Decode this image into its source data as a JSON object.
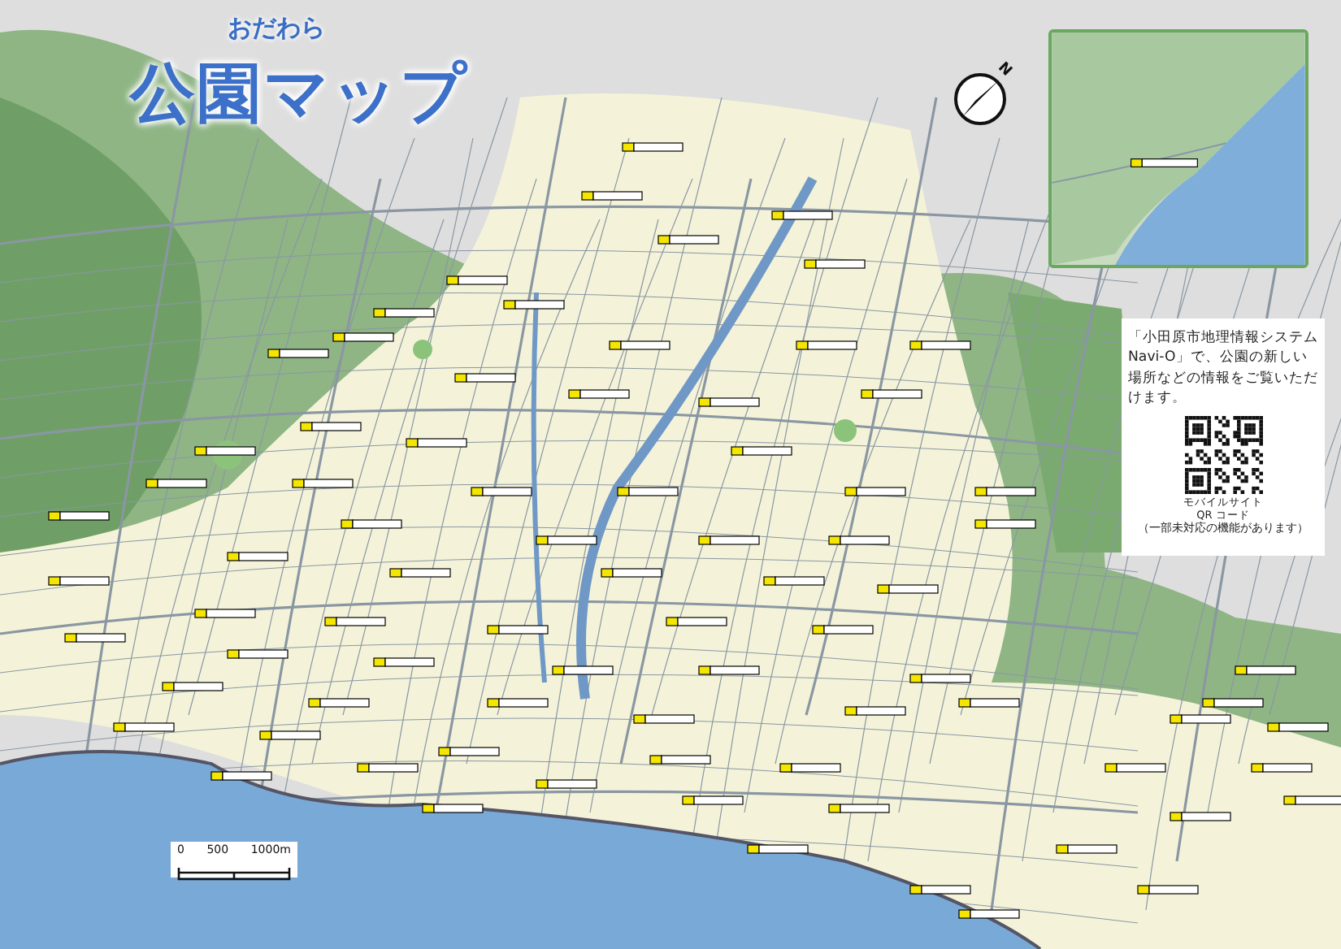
{
  "title": {
    "reading": "おだわら",
    "text": "公園マップ"
  },
  "compass": {
    "letter": "N"
  },
  "info_box": {
    "text": "「小田原市地理情報システム Navi-O」で、公園の新しい場所などの情報をご覧いただけます。",
    "qr_caption": "モバイルサイト",
    "qr_label": "QR コード",
    "note": "（一部未対応の機能があります）"
  },
  "scale_bar": {
    "labels": [
      "0",
      "500",
      "1000m"
    ]
  }
}
